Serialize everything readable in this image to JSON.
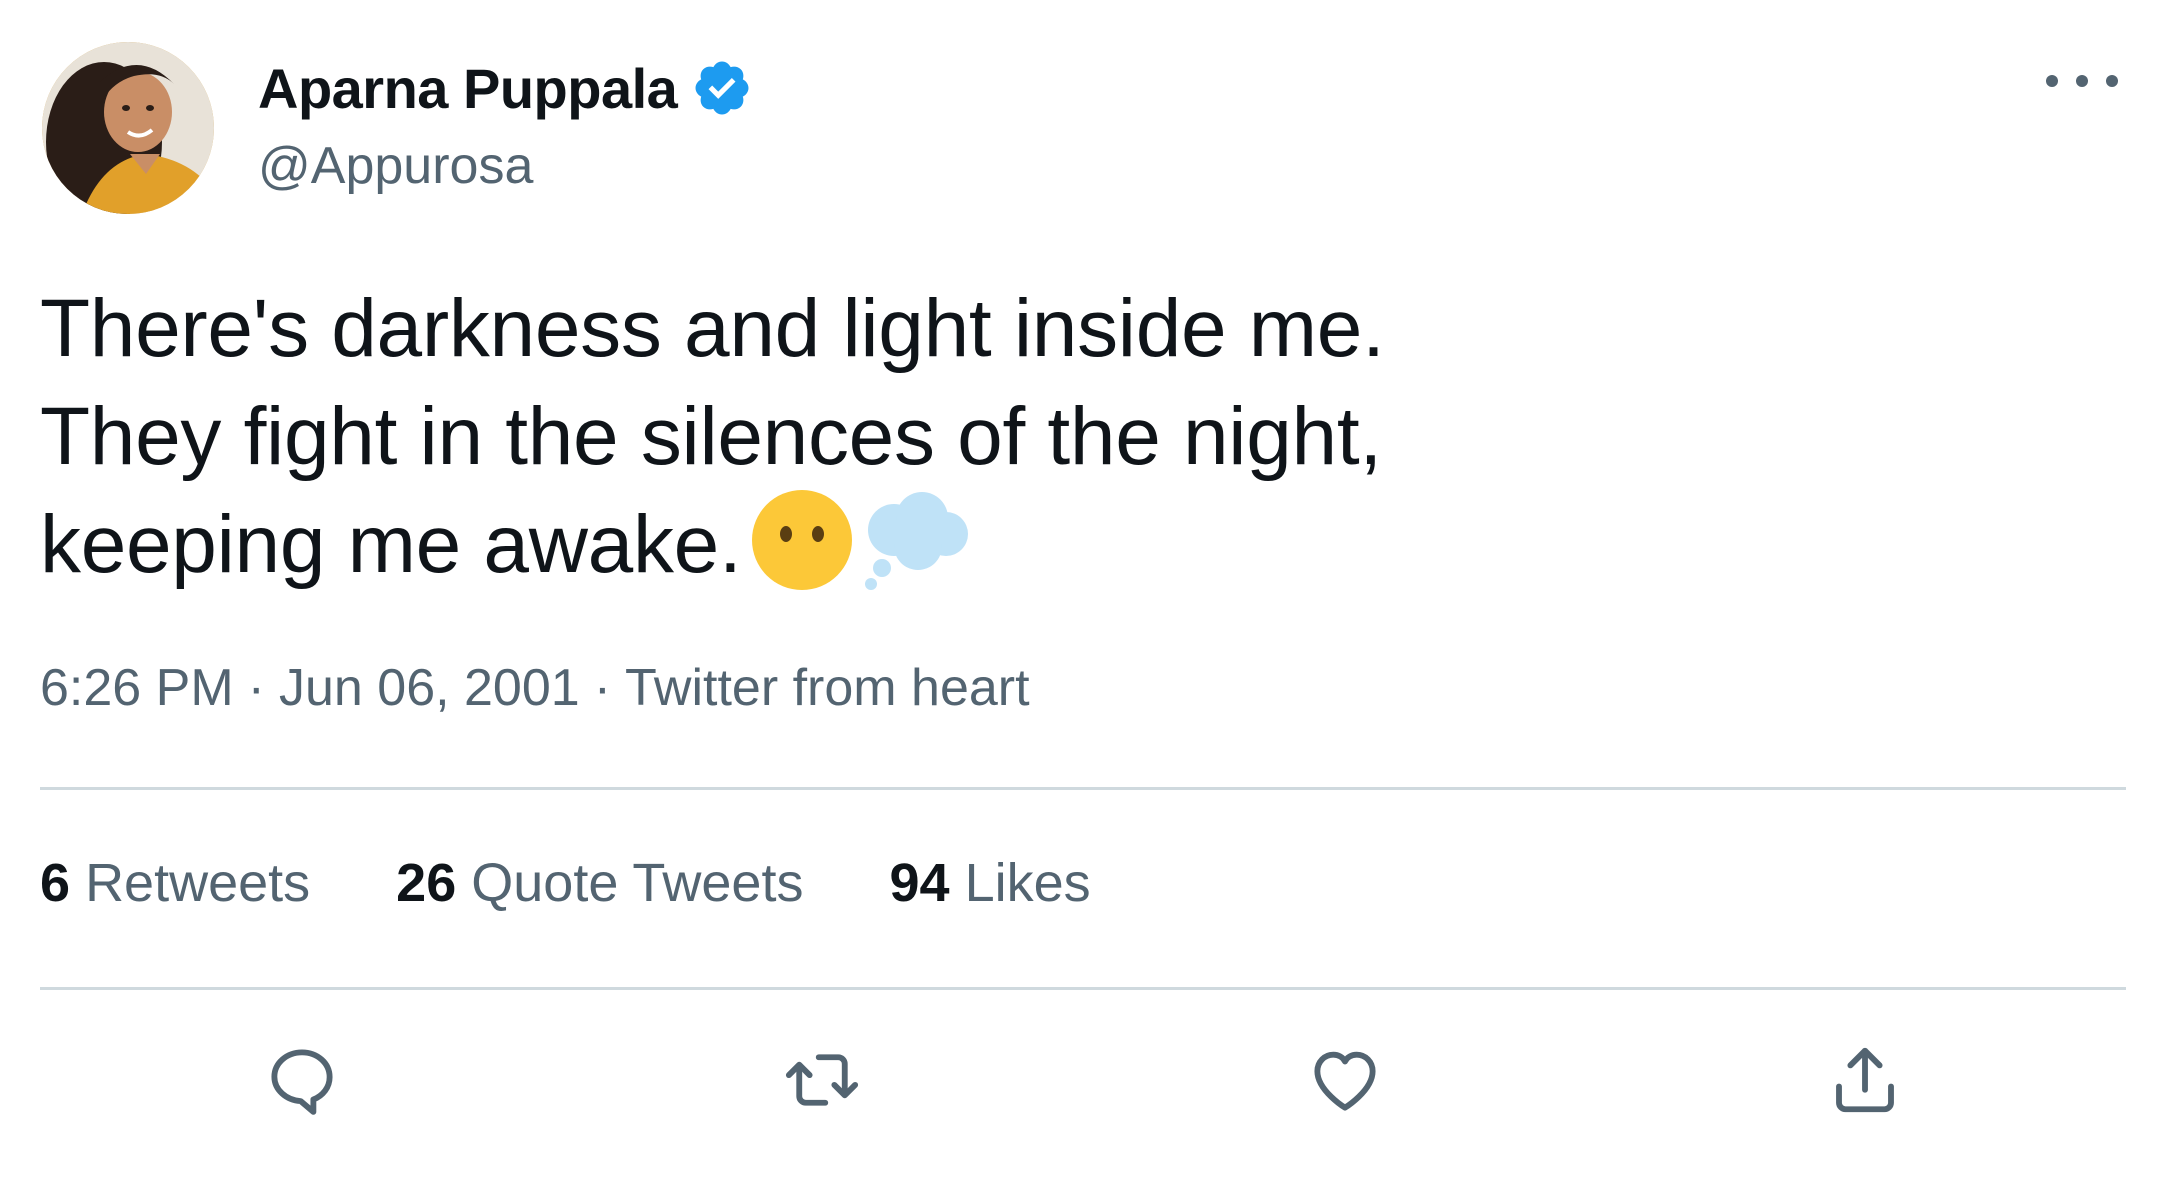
{
  "author": {
    "display_name": "Aparna Puppala",
    "handle": "@Appurosa",
    "verified": true,
    "verified_color": "#1d9bf0"
  },
  "tweet": {
    "text": "There's darkness and light inside me.\nThey fight in the silences of the night,\nkeeping me awake.",
    "emojis": [
      "face-without-mouth",
      "thought-balloon"
    ]
  },
  "meta": {
    "time": "6:26 PM",
    "separator": "·",
    "date": "Jun 06, 2001",
    "source": "Twitter from heart"
  },
  "stats": {
    "retweets_count": "6",
    "retweets_label": "Retweets",
    "quotes_count": "26",
    "quotes_label": "Quote Tweets",
    "likes_count": "94",
    "likes_label": "Likes"
  },
  "actions": [
    "reply-icon",
    "retweet-icon",
    "like-icon",
    "share-icon"
  ],
  "colors": {
    "text_primary": "#0f1419",
    "text_secondary": "#536471",
    "divider": "#cfd9de",
    "accent": "#1d9bf0"
  }
}
